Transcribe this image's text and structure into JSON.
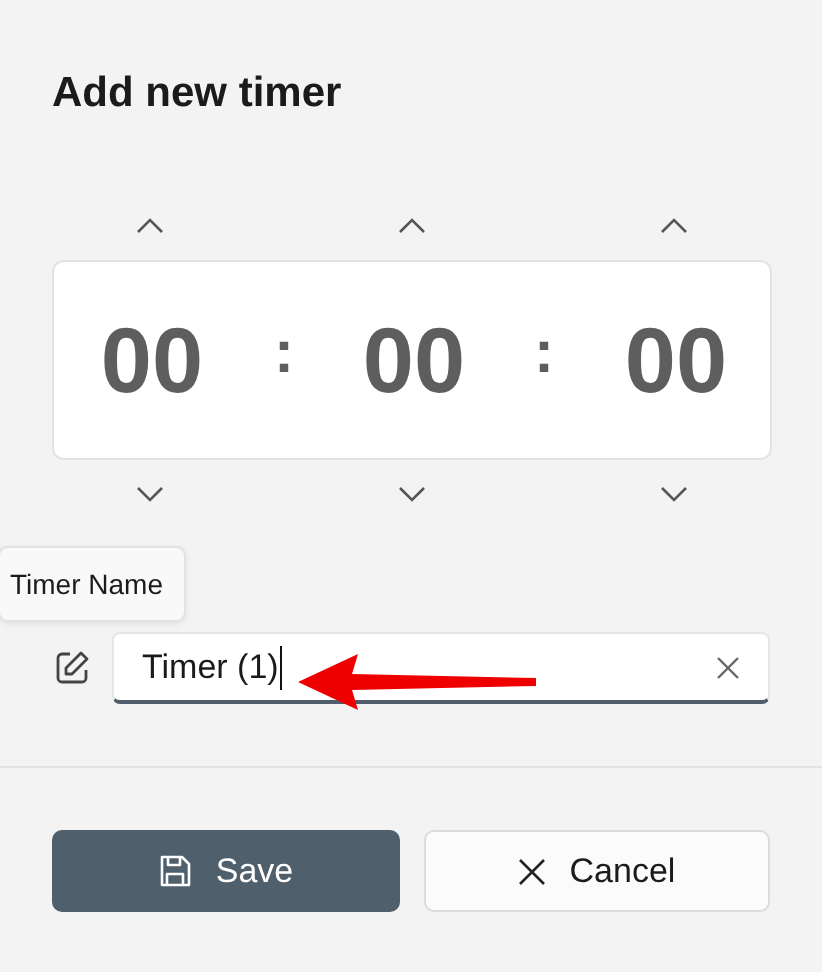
{
  "dialog": {
    "title": "Add new timer"
  },
  "time_parts": [
    {
      "value": "00"
    },
    {
      "value": "00"
    },
    {
      "value": "00"
    }
  ],
  "separators": [
    ":",
    ":"
  ],
  "tooltip": {
    "text": "Timer Name"
  },
  "name_field": {
    "value": "Timer (1)",
    "focused": true
  },
  "annotation": {
    "kind": "arrow"
  },
  "buttons": [
    {
      "label": "Save",
      "kind": "primary"
    },
    {
      "label": "Cancel",
      "kind": "secondary"
    }
  ]
}
